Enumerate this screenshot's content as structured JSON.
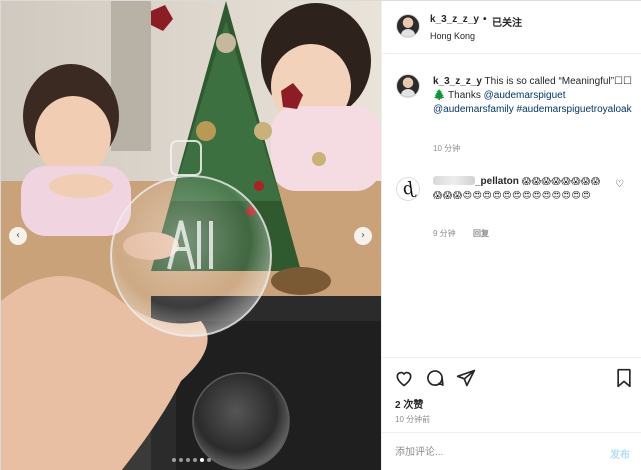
{
  "post": {
    "username": "k_3_z_z_y",
    "follow_separator": "•",
    "follow_label": "已关注",
    "location": "Hong Kong"
  },
  "caption": {
    "username": "k_3_z_z_y",
    "text": "This is so called “Meaningful”☐☐🌲 Thanks",
    "tags": [
      "@audemarspiguet",
      "@audemarsfamily",
      "#audemarspiguetroyaloak"
    ],
    "time": "10 分钟"
  },
  "comment": {
    "username_visible_part": "_pellaton",
    "avatar_glyph": "ɖ",
    "emojis": "😱😱😱😱😱😱😱😱😱😱😱😍😍😍😍😍😍😍😍😍😍😍😍😍",
    "time": "9 分钟",
    "reply_label": "回复",
    "like_icon": "heart-outline-icon"
  },
  "actions": {
    "like_icon": "heart-icon",
    "comment_icon": "comment-icon",
    "share_icon": "share-icon",
    "save_icon": "bookmark-icon"
  },
  "likes_text": "2 次赞",
  "post_time": "10 分钟前",
  "add_comment": {
    "placeholder": "添加评论...",
    "post_label": "发布"
  },
  "carousel": {
    "prev_glyph": "‹",
    "next_glyph": "›",
    "slide_count": 6,
    "active_slide": 4
  },
  "colors": {
    "link": "#00376b",
    "muted": "#8e8e8e",
    "post_button": "#b2dffc",
    "border": "#efefef"
  }
}
